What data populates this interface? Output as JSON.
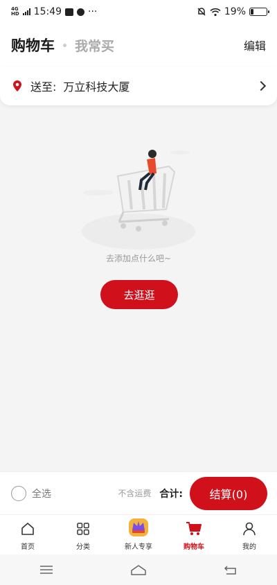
{
  "status": {
    "net": "4G",
    "net_sub": "HD",
    "time": "15:49",
    "more": "···",
    "battery_text": "19%",
    "battery_level": 0.19
  },
  "header": {
    "title": "购物车",
    "tab2": "我常买",
    "edit": "编辑"
  },
  "address": {
    "prefix": "送至:",
    "text": "万立科技大厦"
  },
  "empty": {
    "message": "去添加点什么吧~",
    "button": "去逛逛"
  },
  "checkout": {
    "select_all": "全选",
    "shipping_note": "不含运费",
    "total_label": "合计:",
    "button": "结算(0)"
  },
  "tabs": [
    {
      "label": "首页",
      "icon": "home-icon"
    },
    {
      "label": "分类",
      "icon": "category-icon"
    },
    {
      "label": "新人专享",
      "icon": "crown-icon"
    },
    {
      "label": "购物车",
      "icon": "cart-icon"
    },
    {
      "label": "我的",
      "icon": "user-icon"
    }
  ],
  "colors": {
    "accent": "#d0111b"
  }
}
